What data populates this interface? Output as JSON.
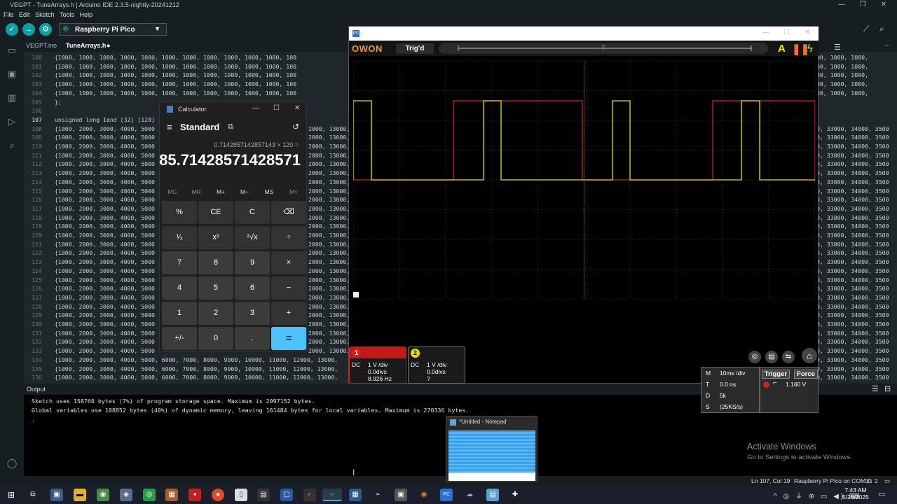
{
  "window": {
    "title": "VEGPT - TuneArrays.h | Arduino IDE 2.3.5-nightly-20241212"
  },
  "menu": [
    "File",
    "Edit",
    "Sketch",
    "Tools",
    "Help"
  ],
  "toolbar": {
    "board": "Raspberry Pi Pico"
  },
  "tabs": [
    {
      "label": "VEGPT.ino"
    },
    {
      "label": "TuneArrays.h"
    }
  ],
  "editor": {
    "lines": [
      {
        "n": "100",
        "text": "{1000, 1000, 1000, 1000, 1000, 1000, 1000, 1000, 1000, 1000, 1000, 100",
        "right": "00, 1000, 1000,"
      },
      {
        "n": "101",
        "text": "{1000, 1000, 1000, 1000, 1000, 1000, 1000, 1000, 1000, 1000, 1000, 100",
        "right": "00, 1000, 1000,"
      },
      {
        "n": "102",
        "text": "{1000, 1000, 1000, 1000, 1000, 1000, 1000, 1000, 1000, 1000, 1000, 100",
        "right": "00, 1000, 1000,"
      },
      {
        "n": "103",
        "text": "{1000, 1000, 1000, 1000, 1000, 1000, 1000, 1000, 1000, 1000, 1000, 100",
        "right": "00, 1000, 1000,"
      },
      {
        "n": "104",
        "text": "{1000, 1000, 1000, 1000, 1000, 1000, 1000, 1000, 1000, 1000, 1000, 100",
        "right": "00, 1000, 1000,"
      },
      {
        "n": "105",
        "text": "};",
        "right": ""
      },
      {
        "n": "106",
        "text": "",
        "right": ""
      },
      {
        "n": "107",
        "text": "unsigned long Iend [32] [128]",
        "right": "",
        "kw": true
      },
      {
        "n": "108",
        "text": "{1000, 2000, 3000, 4000, 5000",
        "mid": "2000, 13000,",
        "right": "0, 33000, 34000, 3500"
      },
      {
        "n": "109",
        "text": "{1000, 2000, 3000, 4000, 5000",
        "mid": "2000, 13000,",
        "right": "0, 33000, 34000, 3500"
      },
      {
        "n": "110",
        "text": "{1000, 2000, 3000, 4000, 5000",
        "mid": "2000, 13000,",
        "right": "0, 33000, 34000, 3500"
      },
      {
        "n": "111",
        "text": "{1000, 2000, 3000, 4000, 5000",
        "mid": "2000, 13000,",
        "right": "0, 33000, 34000, 3500"
      },
      {
        "n": "112",
        "text": "{1000, 2000, 3000, 4000, 5000",
        "mid": "2000, 13000,",
        "right": "0, 33000, 34000, 3500"
      },
      {
        "n": "113",
        "text": "{1000, 2000, 3000, 4000, 5000",
        "mid": "2000, 13000,",
        "right": "0, 33000, 34000, 3500"
      },
      {
        "n": "114",
        "text": "{1000, 2000, 3000, 4000, 5000",
        "mid": "2000, 13000,",
        "right": "0, 33000, 34000, 3500"
      },
      {
        "n": "115",
        "text": "{1000, 2000, 3000, 4000, 5000",
        "mid": "2000, 13000,",
        "right": "0, 33000, 34000, 3500"
      },
      {
        "n": "116",
        "text": "{1000, 2000, 3000, 4000, 5000",
        "mid": "2000, 13000,",
        "right": "0, 33000, 34000, 3500"
      },
      {
        "n": "117",
        "text": "{1000, 2000, 3000, 4000, 5000",
        "mid": "2000, 13000,",
        "right": "0, 33000, 34000, 3500"
      },
      {
        "n": "118",
        "text": "{1000, 2000, 3000, 4000, 5000",
        "mid": "2000, 13000,",
        "right": "0, 33000, 34000, 3500"
      },
      {
        "n": "119",
        "text": "{1000, 2000, 3000, 4000, 5000",
        "mid": "2000, 13000,",
        "right": "0, 33000, 34000, 3500"
      },
      {
        "n": "120",
        "text": "{1000, 2000, 3000, 4000, 5000",
        "mid": "2000, 13000,",
        "right": "0, 33000, 34000, 3500"
      },
      {
        "n": "121",
        "text": "{1000, 2000, 3000, 4000, 5000",
        "mid": "2000, 13000,",
        "right": "0, 33000, 34000, 3500"
      },
      {
        "n": "122",
        "text": "{1000, 2000, 3000, 4000, 5000",
        "mid": "2000, 13000,",
        "right": "0, 33000, 34000, 3500"
      },
      {
        "n": "123",
        "text": "{1000, 2000, 3000, 4000, 5000",
        "mid": "2000, 13000,",
        "right": "0, 33000, 34000, 3500"
      },
      {
        "n": "124",
        "text": "{1000, 2000, 3000, 4000, 5000",
        "mid": "2000, 13000,",
        "right": "0, 33000, 34000, 3500"
      },
      {
        "n": "125",
        "text": "{1000, 2000, 3000, 4000, 5000",
        "mid": "2000, 13000,",
        "right": "0, 33000, 34000, 3500"
      },
      {
        "n": "126",
        "text": "{1000, 2000, 3000, 4000, 5000",
        "mid": "2000, 13000,",
        "right": "0, 33000, 34000, 3500"
      },
      {
        "n": "127",
        "text": "{1000, 2000, 3000, 4000, 5000",
        "mid": "2000, 13000,",
        "right": "0, 33000, 34000, 3500"
      },
      {
        "n": "128",
        "text": "{1000, 2000, 3000, 4000, 5000",
        "mid": "2000, 13000,",
        "right": "0, 33000, 34000, 3500"
      },
      {
        "n": "129",
        "text": "{1000, 2000, 3000, 4000, 5000",
        "mid": "2000, 13000,",
        "right": "0, 33000, 34000, 3500"
      },
      {
        "n": "130",
        "text": "{1000, 2000, 3000, 4000, 5000",
        "mid": "2000, 13000,",
        "right": "0, 33000, 34000, 3500"
      },
      {
        "n": "131",
        "text": "{1000, 2000, 3000, 4000, 5000",
        "mid": "2000, 13000,",
        "right": "0, 33000, 34000, 3500"
      },
      {
        "n": "132",
        "text": "{1000, 2000, 3000, 4000, 5000",
        "mid": "2000, 13000,",
        "right": "0, 33000, 34000, 3500"
      },
      {
        "n": "133",
        "text": "{1000, 2000, 3000, 4000, 5000",
        "mid": "2000, 13000,",
        "right": "0, 33000, 34000, 3500"
      },
      {
        "n": "134",
        "text": "{1000, 2000, 3000, 4000, 5000, 6000, 7000, 8000, 9000, 10000, 11000, 12000, 13000,",
        "right": "0, 33000, 34000, 3500"
      },
      {
        "n": "135",
        "text": "{1000, 2000, 3000, 4000, 5000, 6000, 7000, 8000, 9000, 10000, 11000, 12000, 13000,",
        "right": "0, 33000, 34000, 3500"
      },
      {
        "n": "136",
        "text": "{1000, 2000, 3000, 4000, 5000, 6000, 7000, 8000, 9000, 10000, 11000, 12000, 13000,",
        "right": "0, 33000, 34000, 3500"
      }
    ]
  },
  "output": {
    "title": "Output",
    "lines": [
      "Sketch uses 158760 bytes (7%) of program storage space. Maximum is 2097152 bytes.",
      "Global variables use 108852 bytes (40%) of dynamic memory, leaving 161484 bytes for local variables. Maximum is 270336 bytes.",
      "."
    ]
  },
  "watermark": {
    "line1": "Activate Windows",
    "line2": "Go to Settings to activate Windows."
  },
  "status": {
    "position": "Ln 107, Col 19",
    "board": "Raspberry Pi Pico on COM3",
    "notifications": "2"
  },
  "calculator": {
    "title": "Calculator",
    "mode": "Standard",
    "expression": "0.7142857142857143 × 120 =",
    "display": "85.71428571428571",
    "memory": [
      "MC",
      "MR",
      "M+",
      "M−",
      "MS",
      "M˅"
    ],
    "keys": [
      [
        "%",
        "CE",
        "C",
        "⌫"
      ],
      [
        "¹⁄ₓ",
        "x²",
        "²√x",
        "÷"
      ],
      [
        "7",
        "8",
        "9",
        "×"
      ],
      [
        "4",
        "5",
        "6",
        "−"
      ],
      [
        "1",
        "2",
        "3",
        "+"
      ],
      [
        "+/-",
        "0",
        ".",
        "="
      ]
    ]
  },
  "scope": {
    "brand": "OWON",
    "trigger_state": "Trig'd",
    "ch1": {
      "coupling": "DC",
      "scale": "1 V /div",
      "offset": "0.0divs",
      "freq": "8.926 Hz",
      "label": "1",
      "color": "#d32020"
    },
    "ch2": {
      "coupling": "DC",
      "scale": "1 V /div",
      "offset": "0.0divs",
      "freq": "?",
      "label": "2",
      "color": "#e6e000"
    },
    "timebase": {
      "m_label": "M",
      "m": "10ms /div",
      "t_label": "T",
      "t": "0.0 ns",
      "d_label": "D",
      "d": "5k",
      "s_label": "S",
      "s": "(25KS/s)"
    },
    "trigger": {
      "trigger_label": "Trigger",
      "force_label": "Force",
      "level": "1.160 V"
    }
  },
  "notepad": {
    "title": "*Untitled - Notepad"
  },
  "taskbar": {
    "time": "7:43 AM",
    "date": "5/26/2025"
  }
}
